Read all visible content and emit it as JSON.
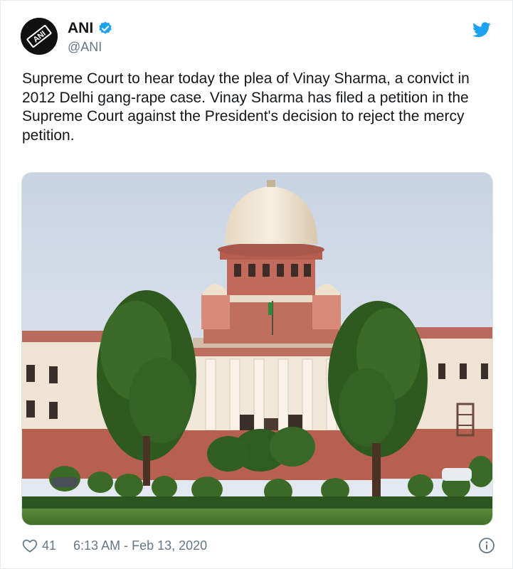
{
  "author": {
    "display_name": "ANI",
    "handle": "@ANI",
    "avatar_text": "ANI"
  },
  "tweet": {
    "text": "Supreme Court to hear today the plea of Vinay Sharma, a convict in 2012 Delhi gang-rape case. Vinay Sharma has filed a petition in the Supreme Court against the President's decision to reject the mercy petition."
  },
  "footer": {
    "like_count": "41",
    "timestamp": "6:13 AM - Feb 13, 2020"
  },
  "icons": {
    "verified": "verified-badge-icon",
    "brand": "twitter-bird-icon",
    "like": "heart-icon",
    "info": "info-icon"
  },
  "colors": {
    "twitter_blue": "#1da1f2",
    "text_primary": "#14171a",
    "text_secondary": "#657786",
    "sandstone_red": "#b5574d",
    "cream": "#f1e8da"
  }
}
